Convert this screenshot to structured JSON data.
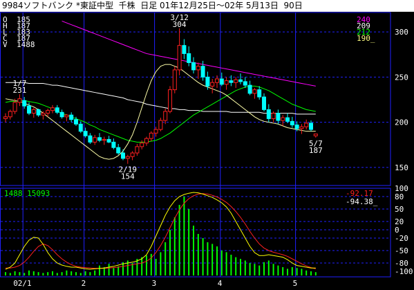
{
  "window": {
    "title": "9984ソフトバンク *東証中型  千株  日足 01年12月25日～02年 5月13日  90日"
  },
  "colors": {
    "background": "#000000",
    "title_bg": "#ffffff",
    "grid": "#2020ff",
    "up_candle": "#ff2020",
    "down_candle": "#00ffff",
    "ma_short": "#ffffff",
    "ma_mid": "#00ff00",
    "ma_long": "#ff00ff",
    "bollinger_upper": "#ffffaa",
    "volume": "#00ff00",
    "osc_fast": "#ffff00",
    "osc_slow": "#ff2020"
  },
  "chart_data": [
    {
      "type": "candlestick",
      "ylim": [
        130,
        320
      ],
      "y_ticks": [
        150,
        200,
        250,
        300
      ],
      "x_labels": [
        "02/1",
        "2",
        "3",
        "4",
        "5"
      ],
      "ohlcv_box": {
        "labels": [
          "O",
          "H",
          "L",
          "C",
          "V"
        ],
        "values": [
          "185",
          "187",
          "183",
          "187",
          "1488"
        ]
      },
      "ma_legend": [
        {
          "value": "240",
          "color": "#ff00ff"
        },
        {
          "value": "209",
          "color": "#ffffff"
        },
        {
          "value": "212",
          "color": "#00ff00"
        },
        {
          "value": "190",
          "color": "#ffff80"
        }
      ],
      "annotations": [
        {
          "date": "1/7",
          "value": "231"
        },
        {
          "date": "3/12",
          "value": "304"
        },
        {
          "date": "2/19",
          "value": "154"
        },
        {
          "date": "5/7",
          "value": "187"
        }
      ],
      "candles": [
        {
          "o": 204,
          "h": 210,
          "l": 200,
          "c": 206
        },
        {
          "o": 206,
          "h": 214,
          "l": 203,
          "c": 212
        },
        {
          "o": 212,
          "h": 226,
          "l": 209,
          "c": 222
        },
        {
          "o": 222,
          "h": 231,
          "l": 218,
          "c": 226
        },
        {
          "o": 224,
          "h": 228,
          "l": 215,
          "c": 218
        },
        {
          "o": 218,
          "h": 222,
          "l": 208,
          "c": 210
        },
        {
          "o": 210,
          "h": 216,
          "l": 205,
          "c": 214
        },
        {
          "o": 214,
          "h": 215,
          "l": 206,
          "c": 208
        },
        {
          "o": 208,
          "h": 212,
          "l": 203,
          "c": 210
        },
        {
          "o": 210,
          "h": 215,
          "l": 206,
          "c": 213
        },
        {
          "o": 213,
          "h": 219,
          "l": 210,
          "c": 216
        },
        {
          "o": 216,
          "h": 219,
          "l": 209,
          "c": 211
        },
        {
          "o": 211,
          "h": 214,
          "l": 204,
          "c": 206
        },
        {
          "o": 206,
          "h": 209,
          "l": 201,
          "c": 208
        },
        {
          "o": 208,
          "h": 211,
          "l": 200,
          "c": 203
        },
        {
          "o": 203,
          "h": 206,
          "l": 196,
          "c": 198
        },
        {
          "o": 198,
          "h": 201,
          "l": 188,
          "c": 190
        },
        {
          "o": 190,
          "h": 194,
          "l": 183,
          "c": 185
        },
        {
          "o": 185,
          "h": 188,
          "l": 176,
          "c": 178
        },
        {
          "o": 178,
          "h": 186,
          "l": 175,
          "c": 183
        },
        {
          "o": 183,
          "h": 188,
          "l": 178,
          "c": 180
        },
        {
          "o": 180,
          "h": 184,
          "l": 175,
          "c": 181
        },
        {
          "o": 181,
          "h": 185,
          "l": 177,
          "c": 178
        },
        {
          "o": 178,
          "h": 182,
          "l": 170,
          "c": 172
        },
        {
          "o": 172,
          "h": 176,
          "l": 164,
          "c": 166
        },
        {
          "o": 166,
          "h": 170,
          "l": 158,
          "c": 160
        },
        {
          "o": 160,
          "h": 164,
          "l": 154,
          "c": 162
        },
        {
          "o": 162,
          "h": 168,
          "l": 158,
          "c": 166
        },
        {
          "o": 166,
          "h": 176,
          "l": 163,
          "c": 173
        },
        {
          "o": 173,
          "h": 180,
          "l": 170,
          "c": 177
        },
        {
          "o": 177,
          "h": 184,
          "l": 174,
          "c": 182
        },
        {
          "o": 182,
          "h": 190,
          "l": 179,
          "c": 188
        },
        {
          "o": 188,
          "h": 195,
          "l": 184,
          "c": 192
        },
        {
          "o": 192,
          "h": 205,
          "l": 190,
          "c": 202
        },
        {
          "o": 202,
          "h": 215,
          "l": 198,
          "c": 212
        },
        {
          "o": 212,
          "h": 240,
          "l": 210,
          "c": 236
        },
        {
          "o": 236,
          "h": 262,
          "l": 232,
          "c": 258
        },
        {
          "o": 258,
          "h": 304,
          "l": 252,
          "c": 285
        },
        {
          "o": 285,
          "h": 292,
          "l": 270,
          "c": 276
        },
        {
          "o": 276,
          "h": 284,
          "l": 262,
          "c": 266
        },
        {
          "o": 266,
          "h": 272,
          "l": 254,
          "c": 258
        },
        {
          "o": 258,
          "h": 266,
          "l": 248,
          "c": 262
        },
        {
          "o": 262,
          "h": 268,
          "l": 246,
          "c": 250
        },
        {
          "o": 250,
          "h": 256,
          "l": 236,
          "c": 240
        },
        {
          "o": 240,
          "h": 248,
          "l": 232,
          "c": 244
        },
        {
          "o": 244,
          "h": 252,
          "l": 238,
          "c": 248
        },
        {
          "o": 248,
          "h": 255,
          "l": 240,
          "c": 242
        },
        {
          "o": 242,
          "h": 250,
          "l": 236,
          "c": 246
        },
        {
          "o": 246,
          "h": 252,
          "l": 240,
          "c": 244
        },
        {
          "o": 244,
          "h": 250,
          "l": 238,
          "c": 247
        },
        {
          "o": 247,
          "h": 254,
          "l": 242,
          "c": 245
        },
        {
          "o": 245,
          "h": 250,
          "l": 238,
          "c": 241
        },
        {
          "o": 241,
          "h": 246,
          "l": 230,
          "c": 232
        },
        {
          "o": 232,
          "h": 238,
          "l": 226,
          "c": 236
        },
        {
          "o": 236,
          "h": 240,
          "l": 225,
          "c": 228
        },
        {
          "o": 228,
          "h": 232,
          "l": 212,
          "c": 214
        },
        {
          "o": 214,
          "h": 220,
          "l": 200,
          "c": 204
        },
        {
          "o": 204,
          "h": 212,
          "l": 200,
          "c": 210
        },
        {
          "o": 210,
          "h": 214,
          "l": 198,
          "c": 202
        },
        {
          "o": 202,
          "h": 208,
          "l": 196,
          "c": 205
        },
        {
          "o": 205,
          "h": 210,
          "l": 199,
          "c": 201
        },
        {
          "o": 201,
          "h": 206,
          "l": 194,
          "c": 197
        },
        {
          "o": 197,
          "h": 201,
          "l": 190,
          "c": 193
        },
        {
          "o": 193,
          "h": 198,
          "l": 187,
          "c": 195
        },
        {
          "o": 195,
          "h": 203,
          "l": 192,
          "c": 199
        },
        {
          "o": 199,
          "h": 202,
          "l": 190,
          "c": 192
        },
        {
          "o": 185,
          "h": 187,
          "l": 183,
          "c": 187
        }
      ],
      "ma_short_values": [
        244,
        244,
        244,
        244,
        244,
        243,
        243,
        243,
        243,
        242,
        241,
        241,
        240,
        239,
        238,
        237,
        236,
        235,
        234,
        233,
        232,
        231,
        230,
        229,
        228,
        227,
        225,
        224,
        223,
        222,
        220,
        219,
        218,
        217,
        216,
        215,
        215,
        214,
        214,
        213,
        213,
        213,
        212,
        212,
        212,
        212,
        212,
        212,
        211,
        211,
        211,
        211,
        211,
        211,
        211,
        210,
        210,
        210,
        210,
        210,
        210,
        210,
        209,
        209,
        209,
        209,
        209
      ],
      "ma_mid_values": [
        222,
        223,
        223,
        224,
        224,
        223,
        222,
        221,
        219,
        217,
        215,
        212,
        210,
        208,
        206,
        204,
        202,
        200,
        197,
        195,
        192,
        190,
        188,
        186,
        184,
        182,
        180,
        179,
        178,
        178,
        178,
        179,
        180,
        182,
        185,
        188,
        192,
        196,
        200,
        204,
        208,
        211,
        214,
        217,
        220,
        223,
        226,
        229,
        232,
        235,
        237,
        239,
        240,
        240,
        239,
        237,
        235,
        232,
        229,
        226,
        223,
        220,
        218,
        216,
        214,
        213,
        212
      ],
      "ma_long_values": [
        312,
        310,
        308,
        306,
        304,
        302,
        300,
        298,
        296,
        294,
        292,
        290,
        288,
        286,
        284,
        282,
        280,
        278,
        276,
        275,
        274,
        273,
        272,
        271,
        270,
        269,
        268,
        267,
        266,
        265,
        264,
        263,
        262,
        261,
        260,
        259,
        258,
        257,
        256,
        255,
        254,
        253,
        252,
        251,
        250,
        249,
        248,
        247,
        246,
        245,
        244,
        243,
        242,
        241,
        240
      ],
      "ma_long_start_index": 12,
      "bollinger_values": [
        226,
        225,
        224,
        223,
        221,
        219,
        217,
        214,
        210,
        206,
        202,
        198,
        194,
        190,
        186,
        182,
        178,
        174,
        170,
        166,
        162,
        160,
        159,
        160,
        163,
        168,
        176,
        186,
        200,
        216,
        232,
        246,
        256,
        262,
        264,
        264,
        262,
        260,
        256,
        252,
        248,
        244,
        241,
        239,
        237,
        235,
        233,
        230,
        226,
        222,
        218,
        214,
        210,
        206,
        203,
        201,
        200,
        199,
        198,
        196,
        194,
        193,
        192,
        191,
        190,
        190,
        190
      ],
      "bollinger_start_index": 0
    },
    {
      "type": "volume+oscillator",
      "ylim": [
        -100,
        100
      ],
      "y_ticks": [
        100,
        80,
        50,
        20,
        0,
        -20,
        -50,
        -80,
        -100
      ],
      "volume_legend": {
        "today": "1488",
        "avg": "15093"
      },
      "osc_legend": {
        "fast": "-92.17",
        "slow": "-94.38"
      },
      "volume": [
        4,
        3,
        5,
        4,
        3,
        6,
        5,
        4,
        3,
        4,
        5,
        3,
        4,
        6,
        5,
        4,
        3,
        5,
        4,
        6,
        12,
        10,
        14,
        9,
        11,
        16,
        18,
        15,
        20,
        22,
        24,
        26,
        20,
        28,
        40,
        55,
        70,
        85,
        95,
        80,
        60,
        50,
        45,
        40,
        38,
        35,
        30,
        28,
        25,
        22,
        20,
        18,
        15,
        14,
        12,
        16,
        18,
        14,
        12,
        10,
        8,
        10,
        9,
        8,
        6,
        5,
        4
      ],
      "osc_fast": [
        -95,
        -90,
        -80,
        -60,
        -40,
        -25,
        -18,
        -20,
        -35,
        -55,
        -70,
        -80,
        -85,
        -88,
        -90,
        -90,
        -92,
        -94,
        -95,
        -94,
        -93,
        -92,
        -90,
        -88,
        -85,
        -82,
        -80,
        -78,
        -75,
        -70,
        -60,
        -40,
        -15,
        10,
        35,
        55,
        70,
        80,
        85,
        88,
        90,
        89,
        86,
        82,
        78,
        72,
        65,
        55,
        40,
        20,
        0,
        -20,
        -40,
        -55,
        -62,
        -62,
        -60,
        -62,
        -64,
        -66,
        -72,
        -80,
        -86,
        -88,
        -90,
        -92,
        -92
      ],
      "osc_slow": [
        -92,
        -92,
        -90,
        -86,
        -78,
        -66,
        -52,
        -40,
        -34,
        -38,
        -48,
        -60,
        -70,
        -78,
        -84,
        -88,
        -90,
        -91,
        -92,
        -93,
        -93,
        -93,
        -92,
        -91,
        -90,
        -88,
        -86,
        -84,
        -82,
        -80,
        -76,
        -68,
        -55,
        -38,
        -18,
        5,
        28,
        48,
        64,
        75,
        82,
        86,
        87,
        86,
        83,
        79,
        73,
        66,
        56,
        44,
        30,
        14,
        -4,
        -20,
        -34,
        -44,
        -50,
        -54,
        -57,
        -60,
        -64,
        -70,
        -76,
        -82,
        -87,
        -91,
        -94
      ]
    }
  ]
}
